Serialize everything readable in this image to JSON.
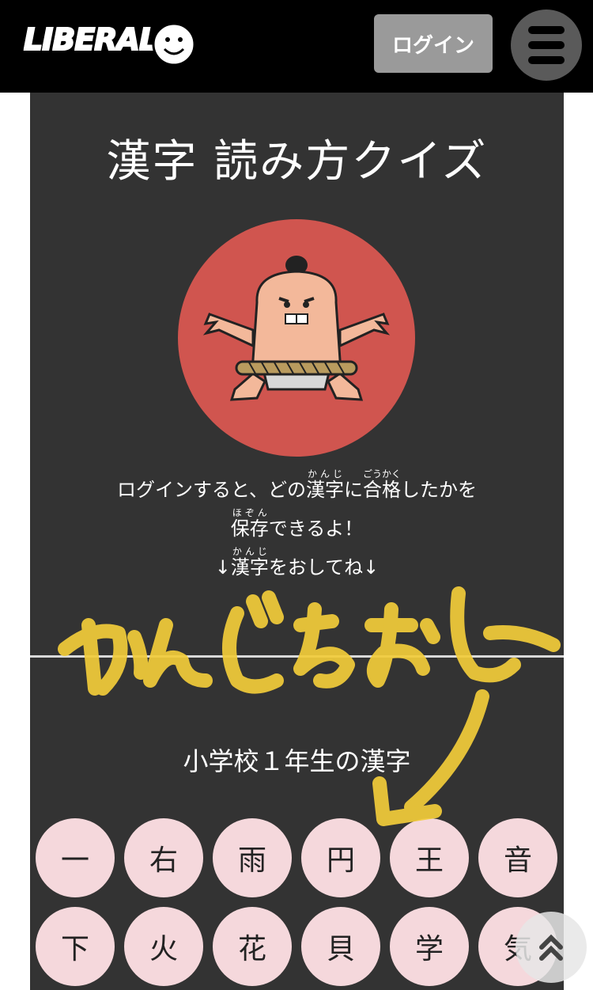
{
  "header": {
    "logo_text": "LIBERAL",
    "login_label": "ログイン"
  },
  "main": {
    "title": "漢字 読み方クイズ",
    "message": {
      "line1_pre": "ログインすると、どの",
      "kanji1": "漢字",
      "kanji1_ruby": "かんじ",
      "mid1": "に",
      "goukaku": "合格",
      "goukaku_ruby": "ごうかく",
      "line1_post": "したかを",
      "hozon": "保存",
      "hozon_ruby": "ほぞん",
      "line2_post": "できるよ！",
      "arrow_left": "↓",
      "kanji2": "漢字",
      "kanji2_ruby": "かんじ",
      "line3_post": "をおしてね",
      "arrow_right": "↓"
    },
    "grade_title": "小学校１年生の漢字",
    "kanji_buttons": [
      "一",
      "右",
      "雨",
      "円",
      "王",
      "音",
      "下",
      "火",
      "花",
      "貝",
      "学",
      "気"
    ]
  },
  "colors": {
    "header_bg": "#000000",
    "panel_bg": "#333333",
    "mascot_bg": "#d0554f",
    "kanji_button_bg": "#f5d8dc",
    "scribble": "#f2cc3a"
  }
}
